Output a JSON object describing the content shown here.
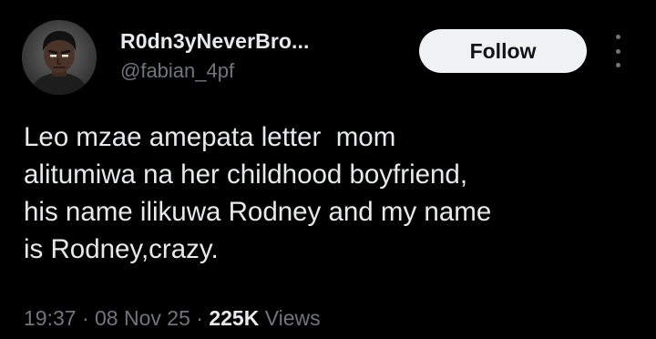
{
  "author": {
    "display_name": "R0dn3yNeverBro...",
    "handle": "@fabian_4pf",
    "avatar": "anime-style-portrait"
  },
  "actions": {
    "follow_label": "Follow",
    "more_icon": "vertical-ellipsis-icon"
  },
  "tweet": {
    "text": "Leo mzae amepata letter  mom\nalitumiwa na her childhood boyfriend,\nhis name ilikuwa Rodney and my name\nis Rodney,crazy."
  },
  "meta": {
    "time": "19:37",
    "sep1": " · ",
    "date": "08 Nov 25",
    "sep2": " · ",
    "views_count": "225K",
    "views_label": " Views"
  },
  "colors": {
    "background": "#000000",
    "primary_text": "#e7e9ea",
    "secondary_text": "#71767b",
    "follow_button_bg": "#eff3f4",
    "follow_button_text": "#0f1419"
  }
}
